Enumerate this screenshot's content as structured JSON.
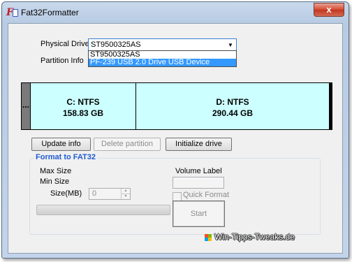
{
  "window": {
    "title": "Fat32Formatter",
    "close_symbol": "x"
  },
  "drive": {
    "physical_drive_label": "Physical Drive",
    "selected": "ST9500325AS",
    "options": [
      "ST9500325AS",
      "PF-239 USB 2.0 Drive USB Device"
    ],
    "highlighted_option_index": 1,
    "partition_info_label": "Partition Info"
  },
  "partitions": {
    "unallocated_marker": "...",
    "items": [
      {
        "name": "C: NTFS",
        "size": "158.83 GB"
      },
      {
        "name": "D: NTFS",
        "size": "290.44 GB"
      }
    ]
  },
  "actions": {
    "update_info": "Update info",
    "delete_partition": "Delete partition",
    "initialize_drive": "Initialize drive"
  },
  "format": {
    "group_title": "Format to FAT32",
    "max_size_label": "Max Size",
    "min_size_label": "Min Size",
    "size_label": "Size(MB)",
    "size_value": "0",
    "volume_label_title": "Volume Label",
    "volume_label_value": "",
    "quick_format_label": "Quick Format",
    "quick_format_checked": false,
    "progress_percent": 0,
    "start_label": "Start"
  },
  "watermark": {
    "text": "Win-Tipps-Tweaks.de"
  },
  "colors": {
    "partition_fill": "#ccffff",
    "group_title": "#1e5bd1",
    "selection": "#3399ff"
  }
}
